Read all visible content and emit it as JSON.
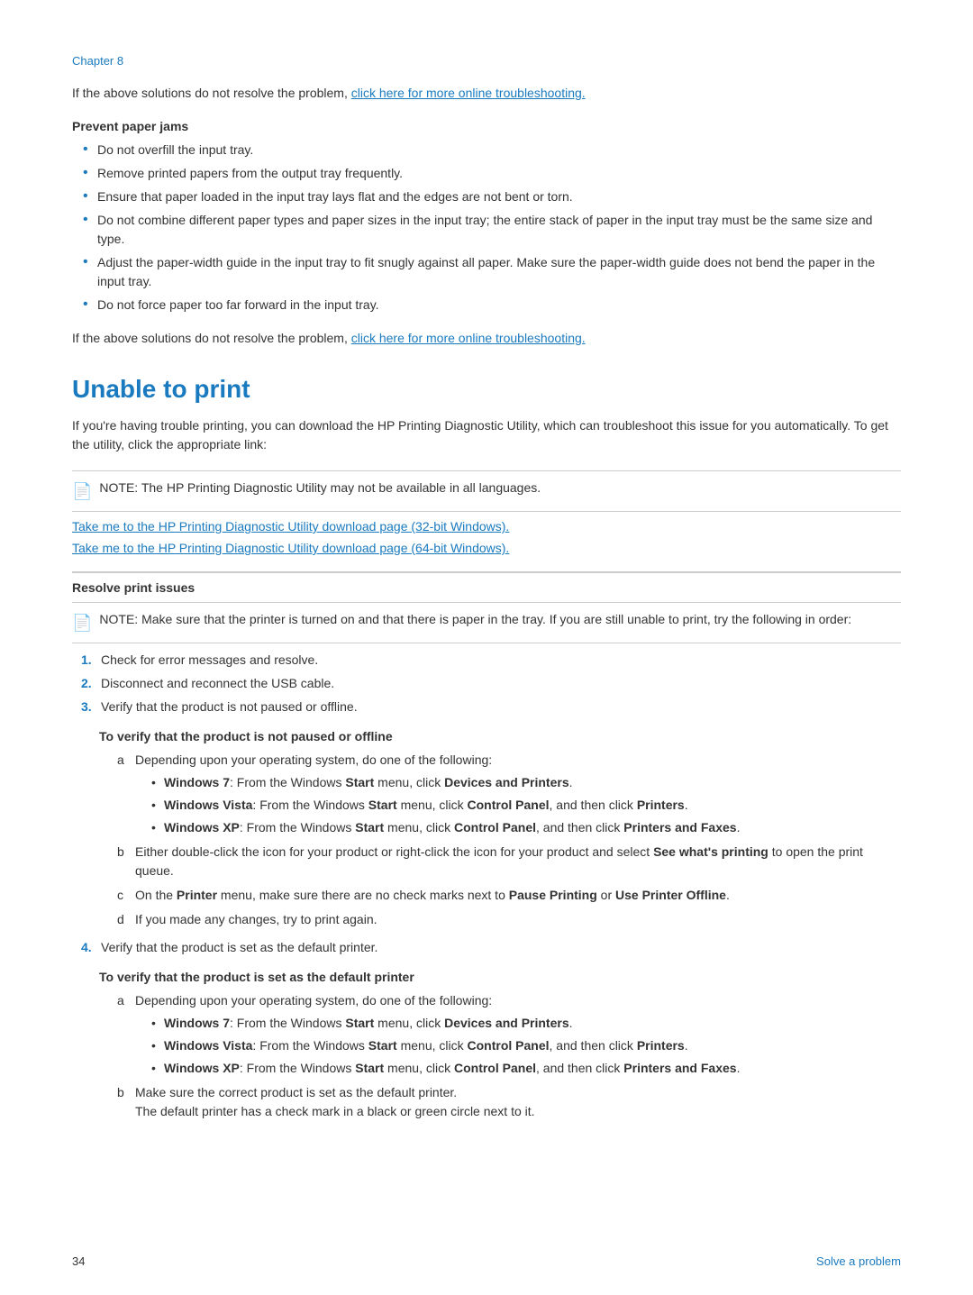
{
  "chapter": {
    "label": "Chapter 8"
  },
  "footer": {
    "page_number": "34",
    "section_label": "Solve a problem"
  },
  "intro_paragraph": "If the above solutions do not resolve the problem,",
  "inline_link1": "click here for more online troubleshooting.",
  "prevent_jams": {
    "heading": "Prevent paper jams",
    "bullets": [
      "Do not overfill the input tray.",
      "Remove printed papers from the output tray frequently.",
      "Ensure that paper loaded in the input tray lays flat and the edges are not bent or torn.",
      "Do not combine different paper types and paper sizes in the input tray; the entire stack of paper in the input tray must be the same size and type.",
      "Adjust the paper-width guide in the input tray to fit snugly against all paper. Make sure the paper-width guide does not bend the paper in the input tray.",
      "Do not force paper too far forward in the input tray."
    ]
  },
  "outro_paragraph": "If the above solutions do not resolve the problem,",
  "inline_link2": "click here for more online troubleshooting.",
  "unable_to_print": {
    "heading": "Unable to print",
    "intro": "If you're having trouble printing, you can download the HP Printing Diagnostic Utility, which can troubleshoot this issue for you automatically. To get the utility, click the appropriate link:",
    "note": "NOTE:   The HP Printing Diagnostic Utility may not be available in all languages.",
    "link_32bit": "Take me to the HP Printing Diagnostic Utility download page (32-bit Windows).",
    "link_64bit": "Take me to the HP Printing Diagnostic Utility download page (64-bit Windows).",
    "resolve_heading": "Resolve print issues",
    "resolve_note": "NOTE:   Make sure that the printer is turned on and that there is paper in the tray. If you are still unable to print, try the following in order:",
    "steps": [
      "Check for error messages and resolve.",
      "Disconnect and reconnect the USB cable.",
      "Verify that the product is not paused or offline."
    ],
    "verify_offline": {
      "sub_heading": "To verify that the product is not paused or offline",
      "steps_alpha": [
        {
          "label": "a",
          "text": "Depending upon your operating system, do one of the following:",
          "bullets": [
            {
              "prefix": "Windows 7",
              "bold": true,
              "rest": ": From the Windows Start menu, click Devices and Printers."
            },
            {
              "prefix": "Windows Vista",
              "bold": true,
              "rest": ": From the Windows Start menu, click Control Panel, and then click Printers."
            },
            {
              "prefix": "Windows XP",
              "bold": true,
              "rest": ": From the Windows Start menu, click Control Panel, and then click Printers and Faxes."
            }
          ]
        },
        {
          "label": "b",
          "text_pre": "Either double-click the icon for your product or right-click the icon for your product and select ",
          "text_bold": "See what's printing",
          "text_post": " to open the print queue."
        },
        {
          "label": "c",
          "text_pre": "On the ",
          "text_bold1": "Printer",
          "text_mid": " menu, make sure there are no check marks next to ",
          "text_bold2": "Pause Printing",
          "text_mid2": " or ",
          "text_bold3": "Use Printer Offline",
          "text_post": "."
        },
        {
          "label": "d",
          "text": "If you made any changes, try to print again."
        }
      ]
    },
    "step4": "Verify that the product is set as the default printer.",
    "verify_default": {
      "sub_heading": "To verify that the product is set as the default printer",
      "steps_alpha": [
        {
          "label": "a",
          "text": "Depending upon your operating system, do one of the following:",
          "bullets": [
            {
              "prefix": "Windows 7",
              "bold": true,
              "rest": ": From the Windows Start menu, click Devices and Printers."
            },
            {
              "prefix": "Windows Vista",
              "bold": true,
              "rest": ": From the Windows Start menu, click Control Panel, and then click Printers."
            },
            {
              "prefix": "Windows XP",
              "bold": true,
              "rest": ": From the Windows Start menu, click Control Panel, and then click Printers and Faxes."
            }
          ]
        },
        {
          "label": "b",
          "text": "Make sure the correct product is set as the default printer.",
          "text2": "The default printer has a check mark in a black or green circle next to it."
        }
      ]
    }
  }
}
